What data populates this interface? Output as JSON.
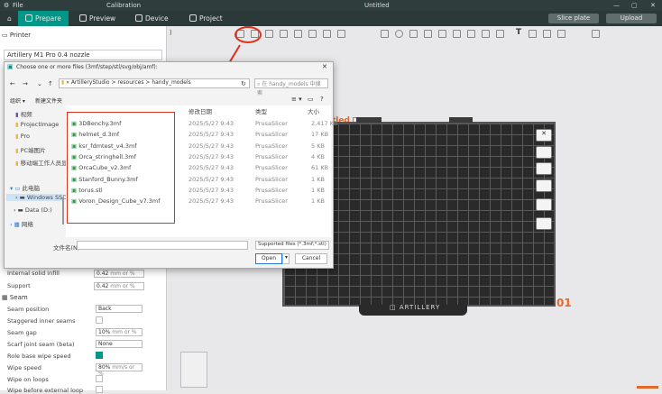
{
  "window": {
    "file_menu": "File",
    "calibration": "Calibration",
    "doc_title": "Untitled"
  },
  "nav": {
    "tabs": [
      {
        "label": "Prepare"
      },
      {
        "label": "Preview"
      },
      {
        "label": "Device"
      },
      {
        "label": "Project"
      }
    ],
    "slice_plate": "Slice plate",
    "upload": "Upload"
  },
  "left": {
    "printer_header": "Printer",
    "printer_name": "Artillery M1 Pro 0.4 nozzle",
    "settings": [
      {
        "label": "Internal solid infill",
        "value": "0.42",
        "unit": "mm or %"
      },
      {
        "label": "Support",
        "value": "0.42",
        "unit": "mm or %"
      }
    ],
    "seam_header": "Seam",
    "seam": [
      {
        "label": "Seam position",
        "value": "Back"
      },
      {
        "label": "Staggered inner seams",
        "value": ""
      },
      {
        "label": "Seam gap",
        "value": "10%",
        "unit": "mm or %"
      },
      {
        "label": "Scarf joint seam (beta)",
        "value": "None"
      },
      {
        "label": "Role base wipe speed",
        "value": ""
      },
      {
        "label": "Wipe speed",
        "value": "80%",
        "unit": "mm/s or %"
      },
      {
        "label": "Wipe on loops",
        "value": ""
      },
      {
        "label": "Wipe before external loop",
        "value": ""
      }
    ]
  },
  "dialog": {
    "title": "Choose one or more files (3mf/step/stl/svg/obj/amf):",
    "breadcrumb": "« ArtilleryStudio > resources > handy_models",
    "search_placeholder": "在 handy_models 中搜索",
    "new_folder": "新建文件夹",
    "col_date": "修改日期",
    "col_type": "类型",
    "col_size": "大小",
    "sidebar": [
      {
        "label": "视频"
      },
      {
        "label": "ProjectImage"
      },
      {
        "label": "Pro"
      },
      {
        "label": "PC端图片"
      },
      {
        "label": "移动端工作人员显示图片"
      },
      {
        "label": "此电脑"
      },
      {
        "label": "Windows SSD"
      },
      {
        "label": "Data (D:)"
      },
      {
        "label": "网络"
      }
    ],
    "files": [
      {
        "name": "3DBenchy.3mf",
        "date": "2025/5/27 9:43",
        "type": "PrusaSlicer",
        "size": "2,417 KB"
      },
      {
        "name": "helmet_d.3mf",
        "date": "2025/5/27 9:43",
        "type": "PrusaSlicer",
        "size": "17 KB"
      },
      {
        "name": "ksr_fdmtest_v4.3mf",
        "date": "2025/5/27 9:43",
        "type": "PrusaSlicer",
        "size": "5 KB"
      },
      {
        "name": "Orca_stringhell.3mf",
        "date": "2025/5/27 9:43",
        "type": "PrusaSlicer",
        "size": "4 KB"
      },
      {
        "name": "OrcaCube_v2.3mf",
        "date": "2025/5/27 9:43",
        "type": "PrusaSlicer",
        "size": "61 KB"
      },
      {
        "name": "Stanford_Bunny.3mf",
        "date": "2025/5/27 9:43",
        "type": "PrusaSlicer",
        "size": "1 KB"
      },
      {
        "name": "torus.stl",
        "date": "2025/5/27 9:43",
        "type": "PrusaSlicer",
        "size": "1 KB"
      },
      {
        "name": "Voron_Design_Cube_v7.3mf",
        "date": "2025/5/27 9:43",
        "type": "PrusaSlicer",
        "size": "1 KB"
      }
    ],
    "filename_label": "文件名(N):",
    "filter": "Supported files (*.3mf;*.stl)",
    "open_button": "Open",
    "cancel_button": "Cancel"
  },
  "canvas": {
    "plate_label": "ARTILLERY",
    "plate_number": "01",
    "untitled": "Untitled"
  },
  "colors": {
    "accent": "#009688",
    "annotation_red": "#e0301e"
  }
}
